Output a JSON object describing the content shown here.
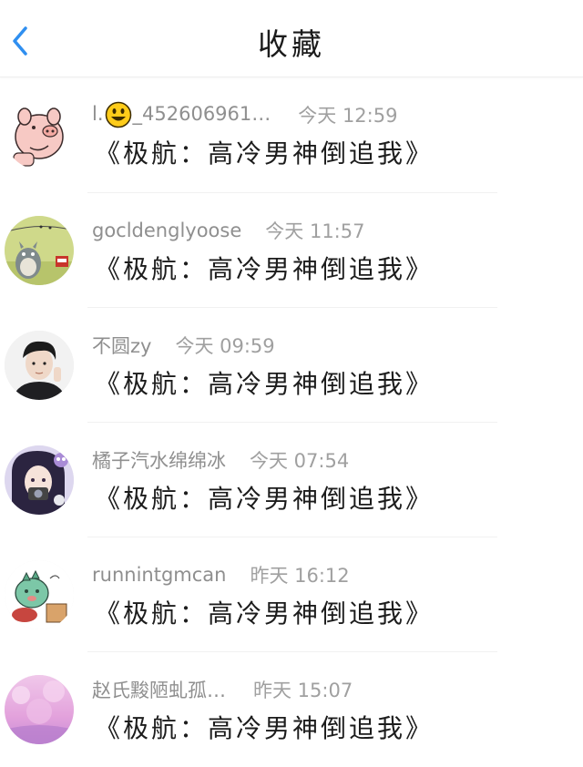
{
  "header": {
    "title": "收藏",
    "back_icon": "chevron-left-icon",
    "accent_color": "#2f8ff0"
  },
  "items": [
    {
      "username_prefix": "l.",
      "username_emoji": "smiley-face-icon",
      "username_suffix": "_452606961…",
      "time": "今天 12:59",
      "title": "《极航：高冷男神倒追我》",
      "avatar": "pink-pig-avatar"
    },
    {
      "username": "gocldenglyoose",
      "time": "今天 11:57",
      "title": "《极航：高冷男神倒追我》",
      "avatar": "totoro-avatar"
    },
    {
      "username": "不圆zy",
      "time": "今天 09:59",
      "title": "《极航：高冷男神倒追我》",
      "avatar": "boy-portrait-avatar"
    },
    {
      "username": "橘子汽水绵绵冰",
      "time": "今天 07:54",
      "title": "《极航：高冷男神倒追我》",
      "avatar": "girl-with-camera-avatar"
    },
    {
      "username": "runnintgmcan",
      "time": "昨天 16:12",
      "title": "《极航：高冷男神倒追我》",
      "avatar": "green-dinosaur-avatar"
    },
    {
      "username": "赵氏黢陋虬孤…",
      "time": "昨天 15:07",
      "title": "《极航：高冷男神倒追我》",
      "avatar": "pink-blossom-avatar"
    }
  ]
}
